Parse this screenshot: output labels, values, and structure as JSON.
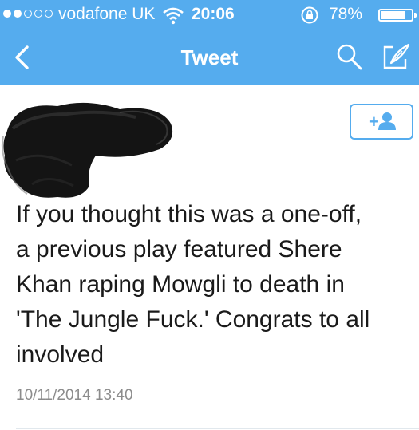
{
  "status_bar": {
    "carrier": "vodafone UK",
    "time": "20:06",
    "battery_percent": "78%",
    "battery_level": 0.78,
    "signal_strength": 2,
    "signal_total": 5,
    "wifi_icon": "wifi-icon",
    "rotation_lock_icon": "rotation-lock-icon"
  },
  "nav_bar": {
    "title": "Tweet",
    "back_icon": "chevron-left-icon",
    "search_icon": "search-icon",
    "compose_icon": "compose-icon",
    "background_color": "#55acee"
  },
  "tweet": {
    "author_avatar": "redacted",
    "follow_label": "+",
    "follow_icon": "add-user-icon",
    "text": "If you thought this was a one-off,\na previous play featured Shere\nKhan raping Mowgli to death in\n'The Jungle Fuck.' Congrats to all\ninvolved",
    "timestamp": "10/11/2014 13:40"
  },
  "colors": {
    "accent": "#55acee",
    "text": "#1a1a1a",
    "muted": "#8c8c8c"
  }
}
